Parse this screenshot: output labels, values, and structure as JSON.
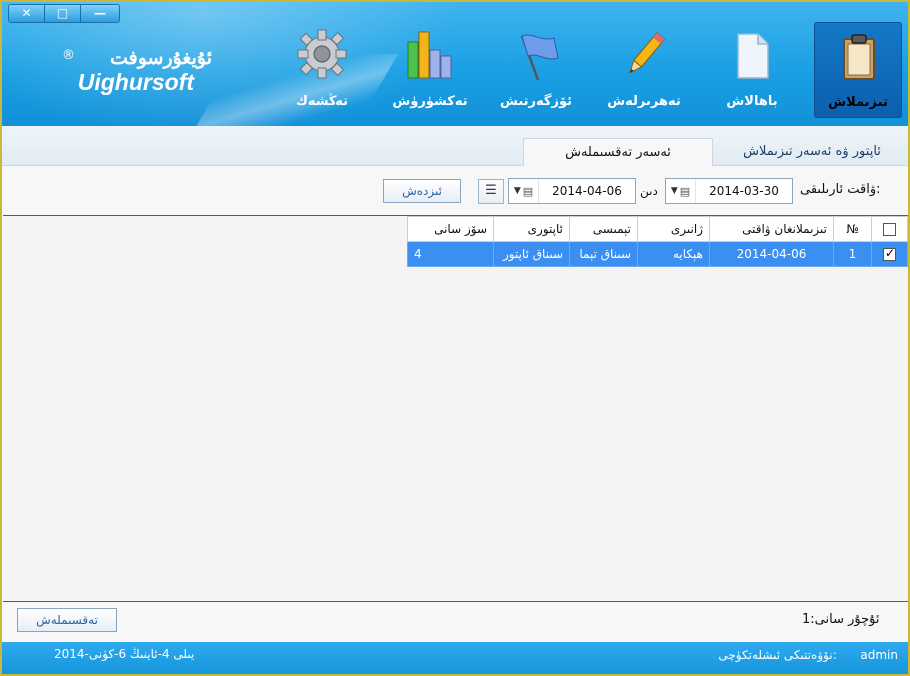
{
  "window": {
    "close": "✕",
    "restore": "□",
    "minimize": "—"
  },
  "logo": {
    "brand_ug": "ئۇيغۇرسوفت",
    "reg": "®",
    "brand_en": "Uighursoft"
  },
  "nav": [
    {
      "label": "تىزىملاش",
      "icon": "clipboard-icon",
      "active": true
    },
    {
      "label": "باھالاش",
      "icon": "document-icon",
      "active": false
    },
    {
      "label": "تەھرىرلەش",
      "icon": "pencil-icon",
      "active": false
    },
    {
      "label": "ئۆزگەرتىش",
      "icon": "flag-icon",
      "active": false
    },
    {
      "label": "تەكشۈرۈش",
      "icon": "bar-chart-icon",
      "active": false
    },
    {
      "label": "تەڭشەك",
      "icon": "gear-icon",
      "active": false
    }
  ],
  "tabs": {
    "active": "ئەسەر تەقسىملەش",
    "inactive": "ئاپتور ۋە ئەسەر تىزىملاش"
  },
  "filter": {
    "time_range_label": "ۋاقت ئارىلىقى:",
    "date_from": "2014-03-30",
    "din": "دىن",
    "date_to": "2014-04-06",
    "search_button": "ئىزدەش"
  },
  "colors": {
    "header": "#1aa0e4",
    "selected_row": "#3b8ff0",
    "status_bar": "#1696dc"
  },
  "table": {
    "headers": [
      "",
      "№",
      "تىزىملانغان ۋاقتى",
      "ژانىرى",
      "تېمىسى",
      "ئاپتورى",
      "سۆز سانى"
    ],
    "rows": [
      {
        "checked": true,
        "no": "1",
        "time": "2014-04-06",
        "genre": "ھېكايە",
        "topic": "سىناق تېما",
        "author": "سىناق ئاپتور",
        "words": "4"
      }
    ]
  },
  "footer": {
    "distribute_button": "تەقسىملەش",
    "record_count": "ئۇچۇر سانى:1"
  },
  "status": {
    "operator": "نۆۋەتتىكى ئىشلەتكۈچى:",
    "user": "admin",
    "date": "2014-يىلى 4-ئاينىڭ 6-كۈنى"
  }
}
